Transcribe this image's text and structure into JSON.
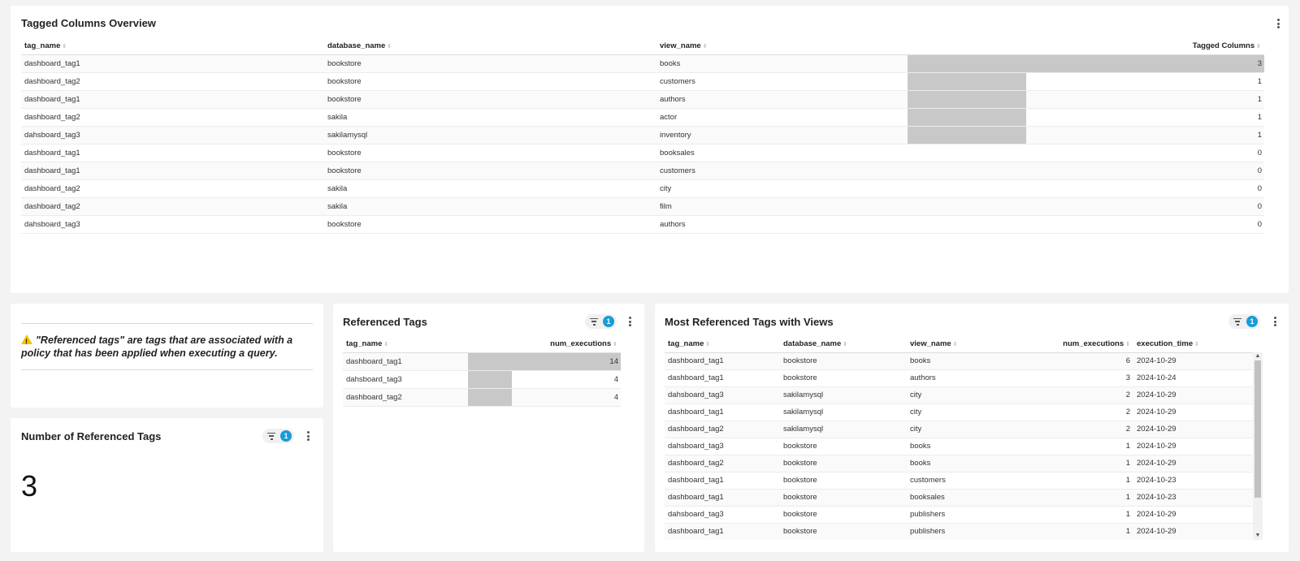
{
  "tagged_columns": {
    "title": "Tagged Columns Overview",
    "columns": [
      "tag_name",
      "database_name",
      "view_name",
      "Tagged Columns"
    ],
    "max": 3,
    "rows": [
      [
        "dashboard_tag1",
        "bookstore",
        "books",
        3
      ],
      [
        "dashboard_tag2",
        "bookstore",
        "customers",
        1
      ],
      [
        "dashboard_tag1",
        "bookstore",
        "authors",
        1
      ],
      [
        "dashboard_tag2",
        "sakila",
        "actor",
        1
      ],
      [
        "dahsboard_tag3",
        "sakilamysql",
        "inventory",
        1
      ],
      [
        "dashboard_tag1",
        "bookstore",
        "booksales",
        0
      ],
      [
        "dashboard_tag1",
        "bookstore",
        "customers",
        0
      ],
      [
        "dashboard_tag2",
        "sakila",
        "city",
        0
      ],
      [
        "dashboard_tag2",
        "sakila",
        "film",
        0
      ],
      [
        "dahsboard_tag3",
        "bookstore",
        "authors",
        0
      ]
    ]
  },
  "note": {
    "text": "\"Referenced tags\" are tags that are associated with a policy that has been applied when executing a query.",
    "icon": "warning-icon"
  },
  "number_of_referenced_tags": {
    "title": "Number of Referenced Tags",
    "filter_count": "1",
    "value": "3"
  },
  "referenced_tags": {
    "title": "Referenced Tags",
    "filter_count": "1",
    "columns": [
      "tag_name",
      "num_executions"
    ],
    "max": 14,
    "rows": [
      [
        "dashboard_tag1",
        14
      ],
      [
        "dahsboard_tag3",
        4
      ],
      [
        "dashboard_tag2",
        4
      ]
    ]
  },
  "most_referenced": {
    "title": "Most Referenced Tags with Views",
    "filter_count": "1",
    "columns": [
      "tag_name",
      "database_name",
      "view_name",
      "num_executions",
      "execution_time"
    ],
    "rows": [
      [
        "dashboard_tag1",
        "bookstore",
        "books",
        "6",
        "2024-10-29"
      ],
      [
        "dashboard_tag1",
        "bookstore",
        "authors",
        "3",
        "2024-10-24"
      ],
      [
        "dahsboard_tag3",
        "sakilamysql",
        "city",
        "2",
        "2024-10-29"
      ],
      [
        "dashboard_tag1",
        "sakilamysql",
        "city",
        "2",
        "2024-10-29"
      ],
      [
        "dashboard_tag2",
        "sakilamysql",
        "city",
        "2",
        "2024-10-29"
      ],
      [
        "dahsboard_tag3",
        "bookstore",
        "books",
        "1",
        "2024-10-29"
      ],
      [
        "dashboard_tag2",
        "bookstore",
        "books",
        "1",
        "2024-10-29"
      ],
      [
        "dashboard_tag1",
        "bookstore",
        "customers",
        "1",
        "2024-10-23"
      ],
      [
        "dashboard_tag1",
        "bookstore",
        "booksales",
        "1",
        "2024-10-23"
      ],
      [
        "dahsboard_tag3",
        "bookstore",
        "publishers",
        "1",
        "2024-10-29"
      ],
      [
        "dashboard_tag1",
        "bookstore",
        "publishers",
        "1",
        "2024-10-29"
      ]
    ]
  }
}
